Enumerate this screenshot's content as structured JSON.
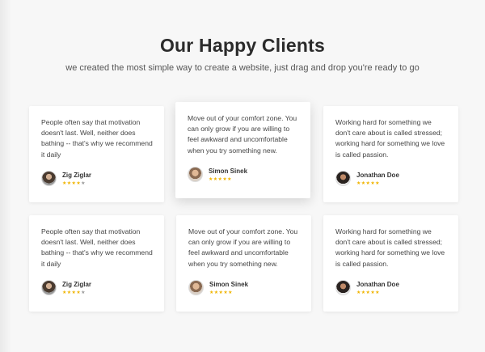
{
  "section": {
    "title": "Our Happy Clients",
    "subtitle": "we created the most simple way to create a website, just drag and drop you're ready to go"
  },
  "testimonials": [
    {
      "quote": "People often say that motivation doesn't last. Well, neither does bathing -- that's why we recommend it daily",
      "author": "Zig Ziglar",
      "rating": 4,
      "stars": "★★★★",
      "stars_empty": "★"
    },
    {
      "quote": "Move out of your comfort zone. You can only grow if you are willing to feel awkward and uncomfortable when you try something new.",
      "author": "Simon Sinek",
      "rating": 5,
      "stars": "★★★★★",
      "stars_empty": ""
    },
    {
      "quote": "Working hard for something we don't care about is called stressed; working hard for something we love is called passion.",
      "author": "Jonathan Doe",
      "rating": 5,
      "stars": "★★★★★",
      "stars_empty": ""
    },
    {
      "quote": "People often say that motivation doesn't last. Well, neither does bathing -- that's why we recommend it daily",
      "author": "Zig Ziglar",
      "rating": 4,
      "stars": "★★★★",
      "stars_empty": "★"
    },
    {
      "quote": "Move out of your comfort zone. You can only grow if you are willing to feel awkward and uncomfortable when you try something new.",
      "author": "Simon Sinek",
      "rating": 5,
      "stars": "★★★★★",
      "stars_empty": ""
    },
    {
      "quote": "Working hard for something we don't care about is called stressed; working hard for something we love is called passion.",
      "author": "Jonathan Doe",
      "rating": 5,
      "stars": "★★★★★",
      "stars_empty": ""
    }
  ],
  "colors": {
    "star_filled": "#f0b400",
    "star_empty": "#999999",
    "background": "#f7f7f7",
    "card": "#ffffff"
  }
}
